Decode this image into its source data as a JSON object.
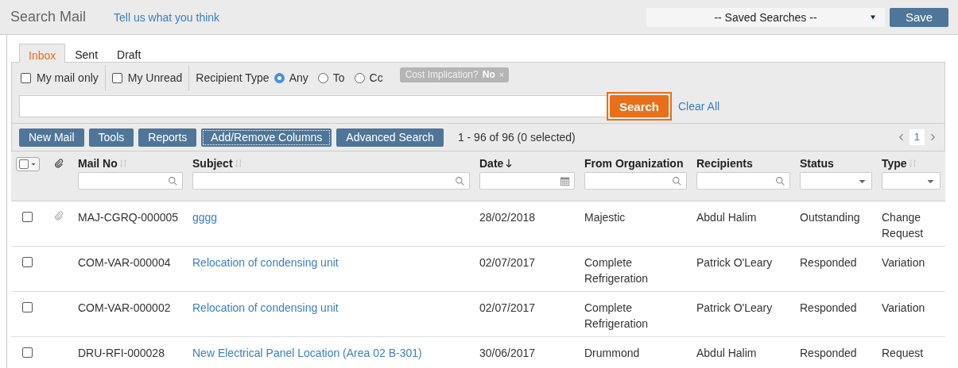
{
  "header": {
    "title": "Search Mail",
    "feedback_link": "Tell us what you think",
    "saved_searches": "-- Saved Searches --",
    "save_button": "Save"
  },
  "tabs": [
    {
      "label": "Inbox",
      "selected": true
    },
    {
      "label": "Sent",
      "selected": false
    },
    {
      "label": "Draft",
      "selected": false
    }
  ],
  "filters": {
    "my_mail_only": {
      "label": "My mail only",
      "checked": false
    },
    "my_unread": {
      "label": "My Unread",
      "checked": false
    },
    "recipient_type": {
      "label": "Recipient Type",
      "options": [
        {
          "label": "Any",
          "selected": true
        },
        {
          "label": "To",
          "selected": false
        },
        {
          "label": "Cc",
          "selected": false
        }
      ]
    },
    "tag": {
      "label": "Cost Implication?",
      "value": "No",
      "remove": "×"
    }
  },
  "search": {
    "button": "Search",
    "clear": "Clear All"
  },
  "toolbar": {
    "buttons": [
      {
        "label": "New Mail",
        "focused": false
      },
      {
        "label": "Tools",
        "focused": false
      },
      {
        "label": "Reports",
        "focused": false
      },
      {
        "label": "Add/Remove Columns",
        "focused": true
      },
      {
        "label": "Advanced Search",
        "focused": false
      }
    ],
    "count": "1 - 96 of 96 (0 selected)",
    "page": "1"
  },
  "table": {
    "columns": [
      {
        "kind": "search",
        "label": "Mail No",
        "sortable": true,
        "sorted": false
      },
      {
        "kind": "search",
        "label": "Subject",
        "sortable": true,
        "sorted": false
      },
      {
        "kind": "date",
        "label": "Date",
        "sortable": true,
        "sorted": true
      },
      {
        "kind": "search",
        "label": "From Organization",
        "sortable": false,
        "sorted": false
      },
      {
        "kind": "search",
        "label": "Recipients",
        "sortable": false,
        "sorted": false
      },
      {
        "kind": "dropdown",
        "label": "Status",
        "sortable": false,
        "sorted": false
      },
      {
        "kind": "dropdown",
        "label": "Type",
        "sortable": true,
        "sorted": false
      }
    ],
    "rows": [
      {
        "checked": false,
        "attachment": true,
        "cells": [
          "MAJ-CGRQ-000005",
          "gggg",
          "28/02/2018",
          "Majestic",
          "Abdul Halim",
          "Outstanding",
          "Change Request"
        ]
      },
      {
        "checked": false,
        "attachment": false,
        "cells": [
          "COM-VAR-000004",
          "Relocation of condensing unit",
          "02/07/2017",
          "Complete Refrigeration",
          "Patrick O'Leary",
          "Responded",
          "Variation"
        ]
      },
      {
        "checked": false,
        "attachment": false,
        "cells": [
          "COM-VAR-000002",
          "Relocation of condensing unit",
          "02/07/2017",
          "Complete Refrigeration",
          "Patrick O'Leary",
          "Responded",
          "Variation"
        ]
      },
      {
        "checked": false,
        "attachment": false,
        "cells": [
          "DRU-RFI-000028",
          "New Electrical Panel Location (Area 02 B-301)",
          "30/06/2017",
          "Drummond",
          "Abdul Halim",
          "Responded",
          "Request"
        ]
      }
    ]
  }
}
